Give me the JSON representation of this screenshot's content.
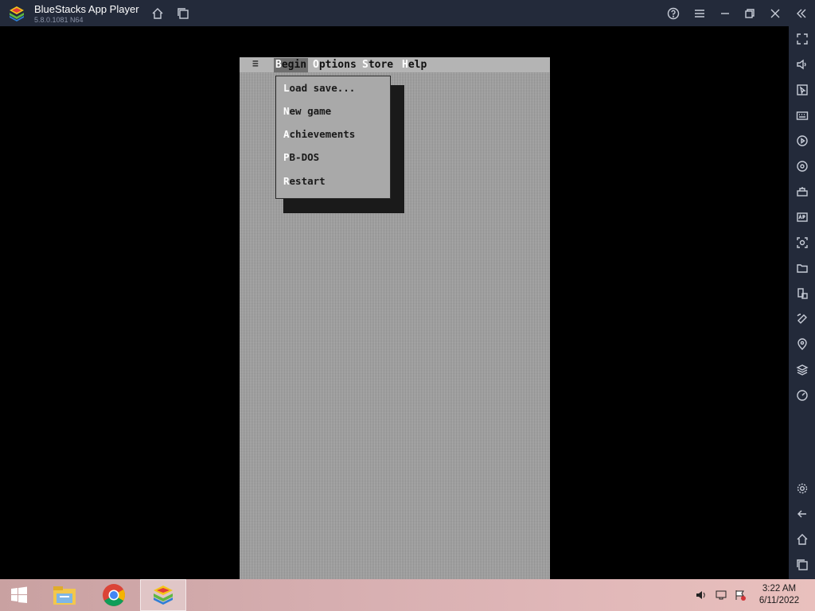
{
  "window": {
    "title": "BlueStacks App Player",
    "version": "5.8.0.1081 N64"
  },
  "titlebar_icons": [
    "home-icon",
    "multi-instance-icon",
    "help-icon",
    "menu-icon",
    "minimize-icon",
    "restore-icon",
    "close-icon",
    "collapse-sidebar-icon"
  ],
  "sidebar_icons": [
    "fullscreen-icon",
    "volume-icon",
    "cursor-lock-icon",
    "keyboard-icon",
    "macro-recorder-icon",
    "operation-sync-icon",
    "game-controls-icon",
    "apk-install-icon",
    "screenshot-icon",
    "folder-icon",
    "multi-instance-icon",
    "rotate-icon",
    "location-icon",
    "layers-icon",
    "eco-mode-icon",
    "settings-icon",
    "back-icon",
    "home-icon",
    "recent-apps-icon"
  ],
  "game": {
    "hamburger": "≡",
    "menu": [
      {
        "hot": "B",
        "rest": "egin",
        "active": true
      },
      {
        "hot": "O",
        "rest": "ptions",
        "active": false
      },
      {
        "hot": "S",
        "rest": "tore",
        "active": false
      },
      {
        "hot": "H",
        "rest": "elp",
        "active": false
      }
    ],
    "dropdown": [
      {
        "hot": "L",
        "rest": "oad save..."
      },
      {
        "hot": "N",
        "rest": "ew game"
      },
      {
        "hot": "A",
        "rest": "chievements"
      },
      {
        "hot": "P",
        "rest": "B-DOS"
      },
      {
        "hot": "R",
        "rest": "estart"
      }
    ]
  },
  "taskbar": {
    "apps": [
      "windows-start-icon",
      "file-explorer-icon",
      "chrome-icon",
      "bluestacks-icon"
    ],
    "tray": [
      "volume-icon",
      "network-icon",
      "action-center-icon"
    ],
    "time": "3:22 AM",
    "date": "6/11/2022"
  },
  "colors": {
    "chrome": "#232a3a",
    "game_bg": "#a8a8a8",
    "taskbar": "#d6aeb0"
  }
}
